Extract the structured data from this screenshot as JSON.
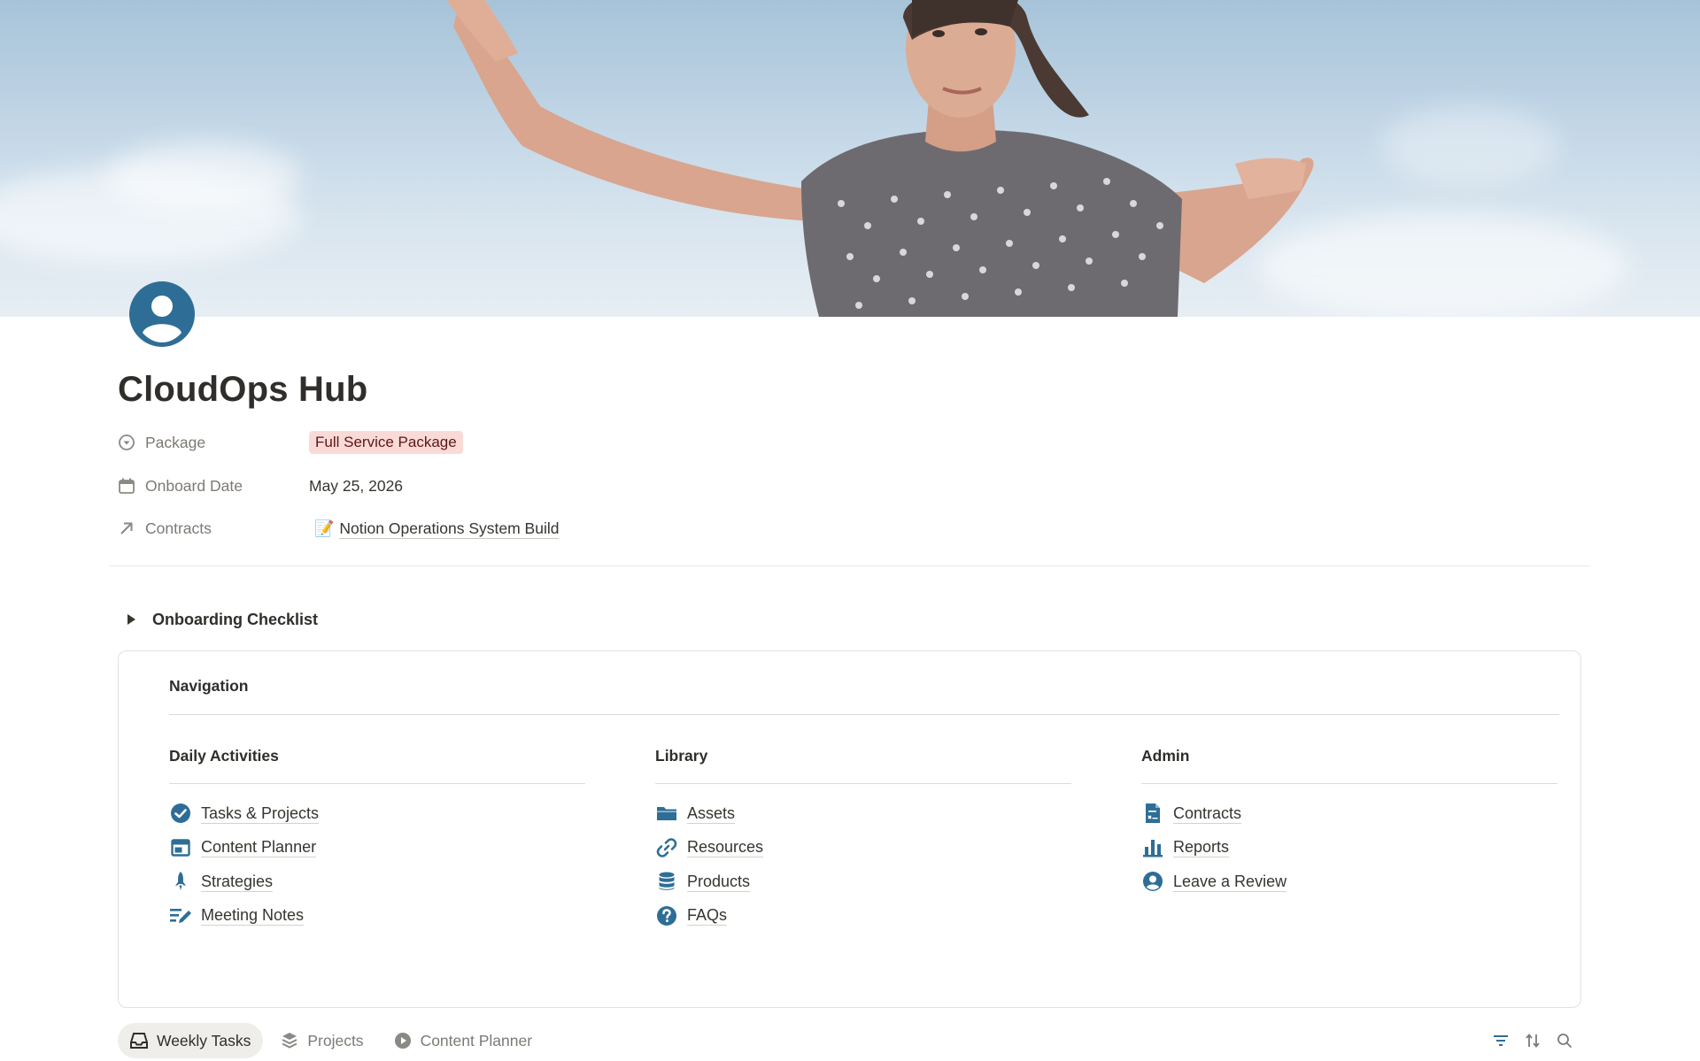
{
  "page": {
    "title": "CloudOps Hub",
    "icon": "user-circle-icon",
    "cover": "cover-photo-woman-arms-outstretched-sky"
  },
  "properties": [
    {
      "icon": "select-circle-icon",
      "label": "Package",
      "value": "Full Service Package",
      "type": "select"
    },
    {
      "icon": "calendar-icon",
      "label": "Onboard Date",
      "value": "May 25, 2026",
      "type": "date"
    },
    {
      "icon": "relation-arrow-icon",
      "label": "Contracts",
      "value": "Notion Operations System Build",
      "value_icon": "📝",
      "type": "relation"
    }
  ],
  "toggle": {
    "label": "Onboarding Checklist",
    "icon": "triangle-right-icon"
  },
  "navigation": {
    "heading": "Navigation",
    "columns": [
      {
        "title": "Daily Activities",
        "items": [
          {
            "label": "Tasks & Projects",
            "icon": "check-circle-icon"
          },
          {
            "label": "Content Planner",
            "icon": "layout-icon"
          },
          {
            "label": "Strategies",
            "icon": "rocket-icon"
          },
          {
            "label": "Meeting Notes",
            "icon": "notes-pen-icon"
          }
        ]
      },
      {
        "title": "Library",
        "items": [
          {
            "label": "Assets",
            "icon": "folder-icon"
          },
          {
            "label": "Resources",
            "icon": "link-icon"
          },
          {
            "label": "Products",
            "icon": "database-icon"
          },
          {
            "label": "FAQs",
            "icon": "question-circle-icon"
          }
        ]
      },
      {
        "title": "Admin",
        "items": [
          {
            "label": "Contracts",
            "icon": "document-icon"
          },
          {
            "label": "Reports",
            "icon": "bar-chart-icon"
          },
          {
            "label": "Leave a Review",
            "icon": "user-circle-icon"
          }
        ]
      }
    ]
  },
  "views": {
    "tabs": [
      {
        "label": "Weekly Tasks",
        "icon": "inbox-icon",
        "active": true
      },
      {
        "label": "Projects",
        "icon": "stack-icon",
        "active": false
      },
      {
        "label": "Content Planner",
        "icon": "play-circle-icon",
        "active": false
      }
    ],
    "tools": [
      "filter-icon",
      "sort-icon",
      "search-icon"
    ]
  },
  "colors": {
    "accent_icon": "#2e6e96",
    "tag_bg": "#fadad7",
    "tag_text": "#5d1715",
    "text": "#37352f",
    "muted": "#7d7a75"
  }
}
